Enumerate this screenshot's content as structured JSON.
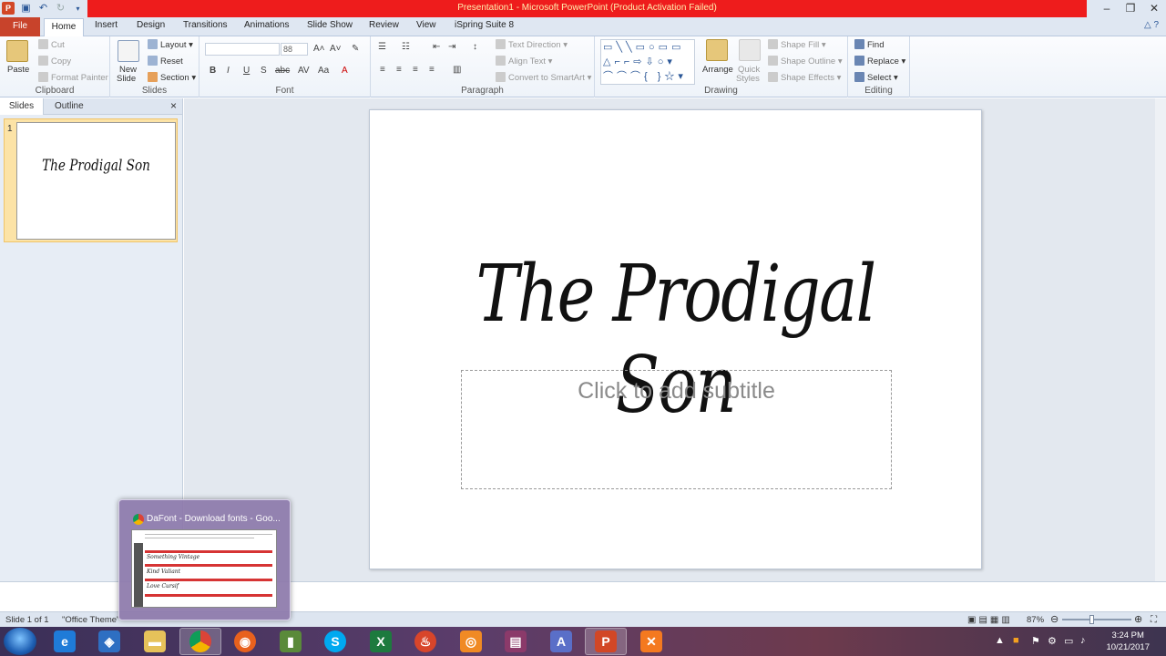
{
  "window": {
    "title": "Presentation1  -  Microsoft PowerPoint (Product Activation Failed)",
    "controls": [
      "–",
      "❐",
      "✕"
    ]
  },
  "tabs": {
    "file": "File",
    "items": [
      "Home",
      "Insert",
      "Design",
      "Transitions",
      "Animations",
      "Slide Show",
      "Review",
      "View",
      "iSpring Suite 8"
    ]
  },
  "ribbon": {
    "clipboard": {
      "name": "Clipboard",
      "paste": "Paste",
      "cut": "Cut",
      "copy": "Copy",
      "format_painter": "Format Painter"
    },
    "slides": {
      "name": "Slides",
      "new_slide": "New",
      "new_slide2": "Slide",
      "layout": "Layout",
      "reset": "Reset",
      "section": "Section"
    },
    "font": {
      "name": "Font",
      "size": "88",
      "bold": "B",
      "italic": "I",
      "underline": "U",
      "strike": "S",
      "shadow": "abc"
    },
    "paragraph": {
      "name": "Paragraph",
      "text_direction": "Text Direction",
      "align_text": "Align Text",
      "convert_smartart": "Convert to SmartArt"
    },
    "drawing": {
      "name": "Drawing",
      "arrange": "Arrange",
      "quick_styles": "Quick",
      "quick_styles2": "Styles",
      "shape_fill": "Shape Fill",
      "shape_outline": "Shape Outline",
      "shape_effects": "Shape Effects"
    },
    "editing": {
      "name": "Editing",
      "find": "Find",
      "replace": "Replace",
      "select": "Select"
    }
  },
  "left_panel": {
    "tabs": [
      "Slides",
      "Outline"
    ],
    "close": "×",
    "slide_number": "1",
    "thumb_title": "The Prodigal Son"
  },
  "slide": {
    "title": "The Prodigal Son",
    "subtitle_placeholder": "Click to add subtitle"
  },
  "status": {
    "slide_info": "Slide 1 of 1",
    "theme": "\"Office Theme\"",
    "zoom": "87%"
  },
  "popup": {
    "title": "DaFont - Download fonts - Goo...",
    "preview_lines": [
      "Something Vintage",
      "Kind Valiant",
      "Love Cursif"
    ]
  },
  "taskbar": {
    "time": "3:24 PM",
    "date": "10/21/2017",
    "apps": [
      "ie",
      "network",
      "files",
      "chrome",
      "firefox",
      "task-manager",
      "skype",
      "excel",
      "burn",
      "vlc-like",
      "winrar",
      "app",
      "powerpoint",
      "xampp"
    ]
  },
  "colors": {
    "titlebar_red": "#ee1c1c",
    "file_tab": "#c8432b",
    "accent": "#2b5797"
  }
}
